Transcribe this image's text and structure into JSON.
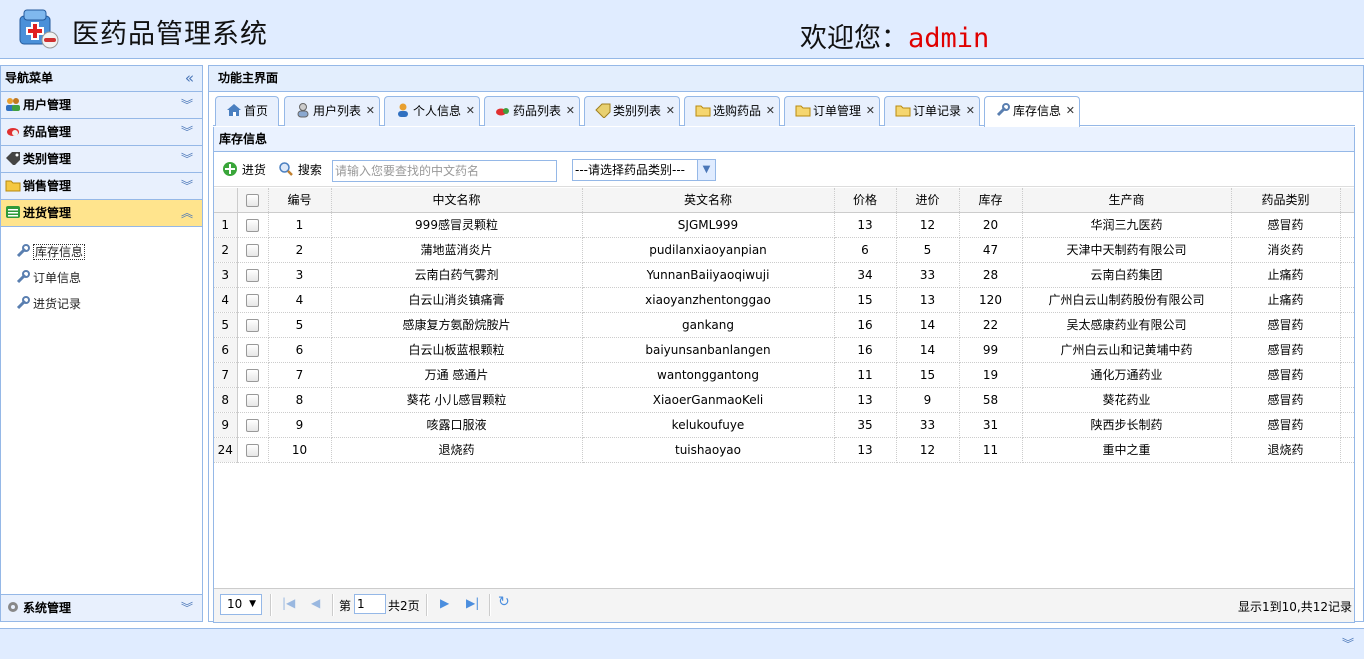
{
  "header": {
    "title": "医药品管理系统",
    "welcome": "欢迎您：",
    "username": "admin"
  },
  "west": {
    "title": "导航菜单",
    "sections": [
      {
        "label": "用户管理",
        "icon": "users-icon"
      },
      {
        "label": "药品管理",
        "icon": "pills-icon"
      },
      {
        "label": "类别管理",
        "icon": "tag-icon"
      },
      {
        "label": "销售管理",
        "icon": "folder-icon"
      },
      {
        "label": "进货管理",
        "icon": "list-icon"
      }
    ],
    "items": [
      "库存信息",
      "订单信息",
      "进货记录"
    ],
    "system": "系统管理"
  },
  "center": {
    "title": "功能主界面",
    "tabs": [
      "首页",
      "用户列表",
      "个人信息",
      "药品列表",
      "类别列表",
      "选购药品",
      "订单管理",
      "订单记录",
      "库存信息"
    ],
    "panel_title": "库存信息",
    "toolbar": {
      "add": "进货",
      "search": "搜索",
      "search_placeholder": "请输入您要查找的中文药名",
      "category_select": "---请选择药品类别---"
    },
    "columns": [
      "编号",
      "中文名称",
      "英文名称",
      "价格",
      "进价",
      "库存",
      "生产商",
      "药品类别"
    ],
    "rows": [
      [
        "1",
        "999感冒灵颗粒",
        "SJGML999",
        "13",
        "12",
        "20",
        "华润三九医药",
        "感冒药"
      ],
      [
        "2",
        "蒲地蓝消炎片",
        "pudilanxiaoyanpian",
        "6",
        "5",
        "47",
        "天津中天制药有限公司",
        "消炎药"
      ],
      [
        "3",
        "云南白药气雾剂",
        "YunnanBaiiyaoqiwuji",
        "34",
        "33",
        "28",
        "云南白药集团",
        "止痛药"
      ],
      [
        "4",
        "白云山消炎镇痛膏",
        "xiaoyanzhentonggao",
        "15",
        "13",
        "120",
        "广州白云山制药股份有限公司",
        "止痛药"
      ],
      [
        "5",
        "感康复方氨酚烷胺片",
        "gankang",
        "16",
        "14",
        "22",
        "吴太感康药业有限公司",
        "感冒药"
      ],
      [
        "6",
        "白云山板蓝根颗粒",
        "baiyunsanbanlangen",
        "16",
        "14",
        "99",
        "广州白云山和记黄埔中药",
        "感冒药"
      ],
      [
        "7",
        "万通 感通片",
        "wantonggantong",
        "11",
        "15",
        "19",
        "通化万通药业",
        "感冒药"
      ],
      [
        "8",
        "葵花 小儿感冒颗粒",
        "XiaoerGanmaoKeli",
        "13",
        "9",
        "58",
        "葵花药业",
        "感冒药"
      ],
      [
        "9",
        "咳露口服液",
        "kelukoufuye",
        "35",
        "33",
        "31",
        "陕西步长制药",
        "感冒药"
      ],
      [
        "10",
        "退烧药",
        "tuishaoyao",
        "13",
        "12",
        "11",
        "重中之重",
        "退烧药"
      ]
    ],
    "row_ids": [
      "1",
      "2",
      "3",
      "4",
      "5",
      "6",
      "7",
      "8",
      "9",
      "24"
    ],
    "pager": {
      "size": "10",
      "page_prefix": "第",
      "page": "1",
      "page_suffix": "共2页",
      "info": "显示1到10,共12记录"
    }
  }
}
